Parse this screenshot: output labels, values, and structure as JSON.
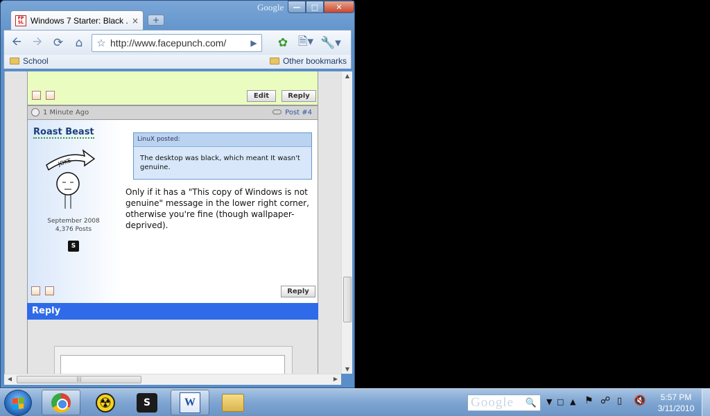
{
  "window": {
    "tab_title": "Windows 7 Starter: Black ...",
    "tab_close": "×",
    "new_tab": "+",
    "brand": "Google",
    "favicon_top": "FP",
    "favicon_bottom": "SL"
  },
  "toolbar": {
    "url": "http://www.facepunch.com/"
  },
  "bookmarks": {
    "left": "School",
    "right": "Other bookmarks"
  },
  "prev_post": {
    "edit_label": "Edit",
    "reply_label": "Reply"
  },
  "post": {
    "time": "1 Minute Ago",
    "post_number": "Post #4",
    "username": "Roast Beast",
    "joined": "September 2008",
    "posts": "4,376 Posts",
    "avatar_text": "JOKE",
    "quote_author": "LinuX posted:",
    "quote_text": "The desktop was black, which meant It wasn't genuine.",
    "body": "Only if it has a \"This copy of Windows is not genuine\" message in the lower right corner, otherwise you're fine (though wallpaper-deprived).",
    "reply_label": "Reply"
  },
  "reply_section": {
    "title": "Reply"
  },
  "taskbar": {
    "search_placeholder": "Google",
    "time": "5:57 PM",
    "date": "3/11/2010"
  }
}
